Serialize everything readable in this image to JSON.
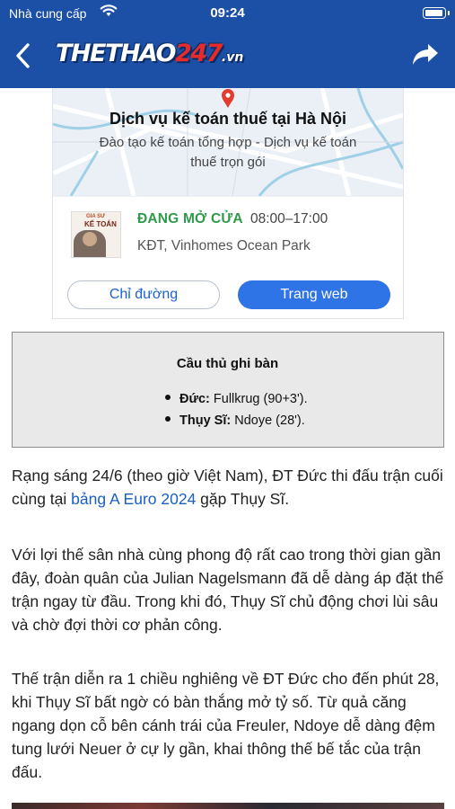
{
  "status_bar": {
    "carrier": "Nhà cung cấp",
    "time": "09:24"
  },
  "header": {
    "logo_main": "THETHAO",
    "logo_number": "247",
    "logo_tld": ".vn",
    "back_icon": "chevron-left-icon",
    "share_icon": "share-icon",
    "background_color": "#1c4fa6"
  },
  "ad": {
    "title": "Dịch vụ kế toán thuế tại Hà Nội",
    "subtitle": "Đào tạo kế toán tổng hợp - Dịch vụ kế toán thuế trọn gói",
    "thumb_line1": "GIA SƯ",
    "thumb_line2": "KẾ TOÁN",
    "status": "ĐANG MỞ CỬA",
    "hours": "08:00–17:00",
    "address": "KĐT, Vinhomes Ocean Park",
    "directions_label": "Chỉ đường",
    "website_label": "Trang web"
  },
  "scorers": {
    "heading": "Cầu thủ ghi bàn",
    "items": [
      {
        "team": "Đức:",
        "detail": " Fullkrug (90+3')."
      },
      {
        "team": "Thụy Sĩ:",
        "detail": " Ndoye (28')."
      }
    ]
  },
  "article": {
    "p1_before": "Rạng sáng 24/6 (theo giờ Việt Nam), ĐT Đức thi đấu trận cuối cùng tại ",
    "p1_link": "bảng A Euro 2024",
    "p1_after": " gặp Thụy Sĩ.",
    "p2": "Với lợi thế sân nhà cùng phong độ rất cao trong thời gian gần đây, đoàn quân của Julian Nagelsmann đã dễ dàng áp đặt thế trận ngay từ đầu. Trong khi đó, Thụy Sĩ chủ động chơi lùi sâu và chờ đợi thời cơ phản công.",
    "p3": "Thế trận diễn ra 1 chiều nghiêng về ĐT Đức cho đến phút 28, khi Thụy Sĩ bất ngờ có bàn thắng mở tỷ số. Từ quả căng ngang dọn cỗ bên cánh trái của Freuler, Ndoye dễ dàng đệm tung lưới Neuer ở cự ly gần, khai thông thế bế tắc của trận đấu."
  }
}
